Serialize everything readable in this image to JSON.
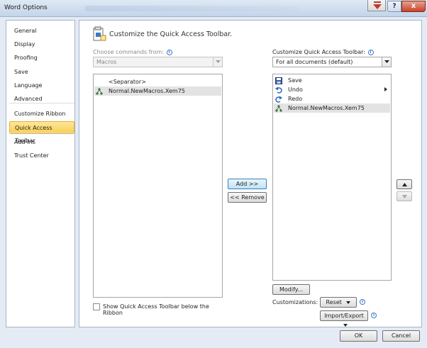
{
  "window": {
    "title": "Word Options",
    "help_label": "?",
    "close_label": "x"
  },
  "nav": {
    "items": [
      {
        "label": "General"
      },
      {
        "label": "Display"
      },
      {
        "label": "Proofing"
      },
      {
        "label": "Save"
      },
      {
        "label": "Language"
      },
      {
        "label": "Advanced"
      },
      {
        "label": "Customize Ribbon"
      },
      {
        "label": "Quick Access Toolbar",
        "active": true
      },
      {
        "label": "Add-Ins"
      },
      {
        "label": "Trust Center"
      }
    ]
  },
  "panel": {
    "heading": "Customize the Quick Access Toolbar.",
    "choose_label": "Choose commands from:",
    "choose_value": "Macros",
    "customize_label": "Customize Quick Access Toolbar:",
    "customize_value": "For all documents (default)",
    "left_list": [
      {
        "label": "<Separator>",
        "icon": "none"
      },
      {
        "label": "Normal.NewMacros.Xem75",
        "icon": "macro-icon",
        "selected": true
      }
    ],
    "right_list": [
      {
        "label": "Save",
        "icon": "save-icon"
      },
      {
        "label": "Undo",
        "icon": "undo-icon",
        "has_submenu": true
      },
      {
        "label": "Redo",
        "icon": "redo-icon"
      },
      {
        "label": "Normal.NewMacros.Xem75",
        "icon": "macro-icon",
        "selected": true
      }
    ],
    "add_label": "Add >>",
    "remove_label": "<< Remove",
    "modify_label": "Modify...",
    "customizations_label": "Customizations:",
    "reset_label": "Reset",
    "import_export_label": "Import/Export",
    "show_below_label_line1": "Show Quick Access Toolbar below the",
    "show_below_label_line2": "Ribbon"
  },
  "footer": {
    "ok_label": "OK",
    "cancel_label": "Cancel"
  },
  "colors": {
    "active_nav": "#f9cf54",
    "selection": "#e3e3e3",
    "accent_blue": "#3c78c8"
  }
}
